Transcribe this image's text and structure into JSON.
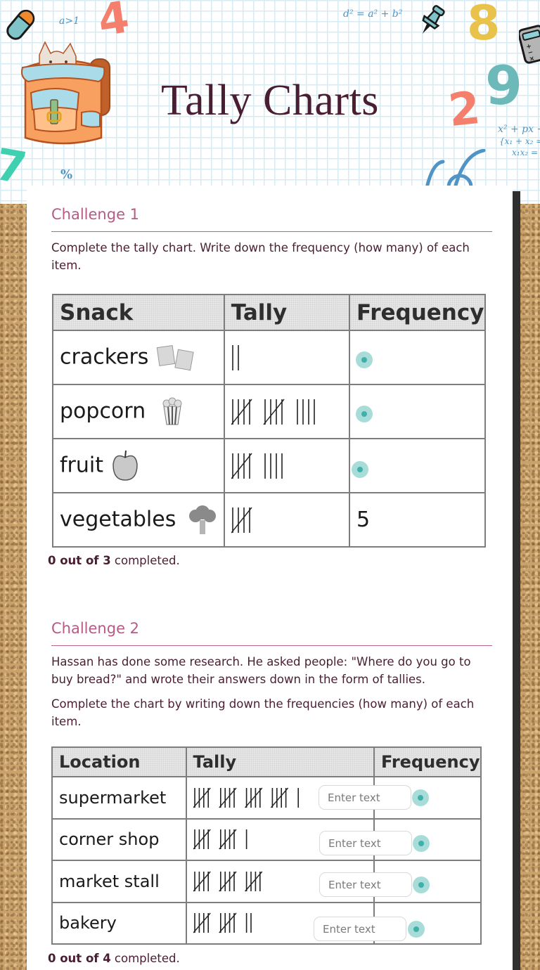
{
  "page": {
    "title": "Tally Charts"
  },
  "header_decorations": {
    "math_text": [
      "a>1",
      "d² = a² + b²",
      "x² + px +",
      "{x₁ + x₂ =",
      "x₁x₂ =",
      "%"
    ],
    "numbers": [
      "4",
      "8",
      "2",
      "9",
      "7"
    ],
    "icons": [
      "eraser-icon",
      "backpack-cats-illustration",
      "pushpin-icon",
      "calculator-icon"
    ]
  },
  "colors": {
    "title": "#4a1e32",
    "challenge_heading": "#b85a86",
    "body_text": "#4a1e32",
    "answer_dot": "#3fb0aa",
    "answer_dot_halo": "#a8dcd9",
    "scrollbar": "#2f2f2f"
  },
  "challenge1": {
    "heading": "Challenge 1",
    "instructions": "Complete the tally chart. Write down the frequency (how many) of each item.",
    "table": {
      "headers": [
        "Snack",
        "Tally",
        "Frequency"
      ],
      "rows": [
        {
          "item": "crackers",
          "icon": "crackers-icon",
          "tally": 2,
          "frequency": ""
        },
        {
          "item": "popcorn",
          "icon": "popcorn-icon",
          "tally": 14,
          "frequency": ""
        },
        {
          "item": "fruit",
          "icon": "apple-icon",
          "tally": 9,
          "frequency": ""
        },
        {
          "item": "vegetables",
          "icon": "broccoli-icon",
          "tally": 5,
          "frequency": "5"
        }
      ]
    },
    "status_count": "0 out of 3",
    "status_suffix": " completed."
  },
  "challenge2": {
    "heading": "Challenge 2",
    "intro": "Hassan has done some research. He asked people: \"Where do you go to buy bread?\" and wrote their answers down in the form of tallies.",
    "instructions": "Complete the chart by writing down the frequencies (how many) of each item.",
    "table": {
      "headers": [
        "Location",
        "Tally",
        "Frequency"
      ],
      "rows": [
        {
          "item": "supermarket",
          "tally": 21,
          "input_placeholder": "Enter text",
          "input_value": ""
        },
        {
          "item": "corner shop",
          "tally": 11,
          "input_placeholder": "Enter text",
          "input_value": ""
        },
        {
          "item": "market stall",
          "tally": 15,
          "input_placeholder": "Enter text",
          "input_value": ""
        },
        {
          "item": "bakery",
          "tally": 12,
          "input_placeholder": "Enter text",
          "input_value": ""
        }
      ]
    },
    "status_count": "0 out of 4",
    "status_suffix": " completed."
  }
}
